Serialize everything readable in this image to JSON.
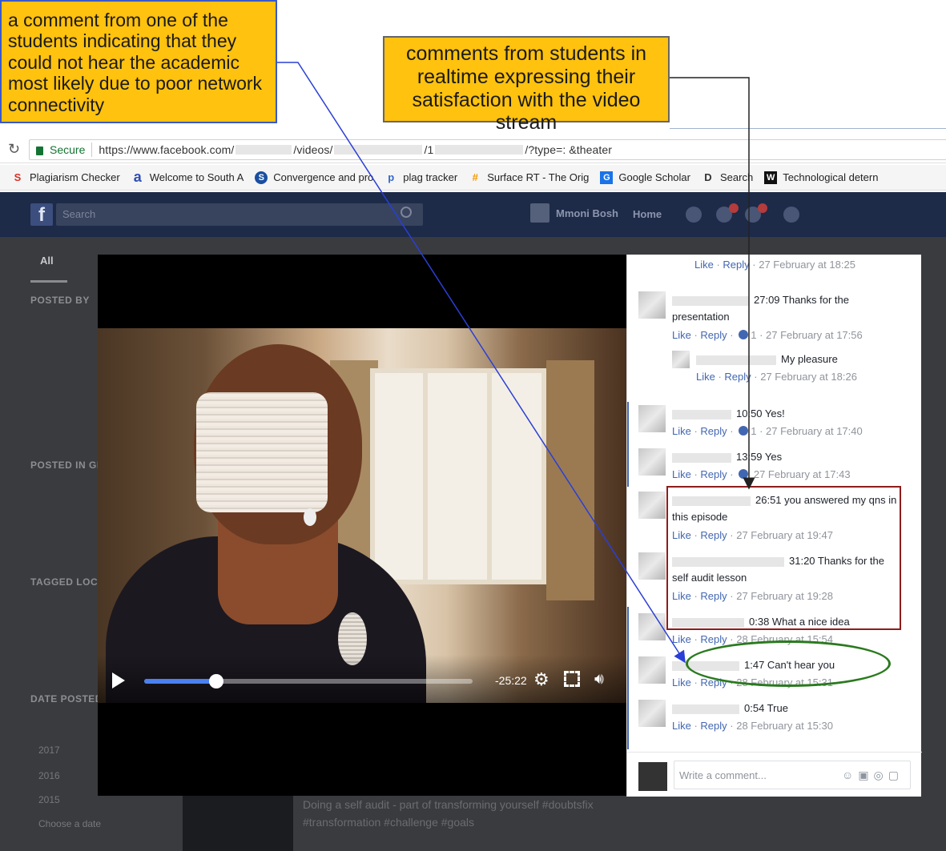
{
  "annotations": {
    "left_note": "a comment from one of the students indicating that they could not hear the academic most likely due to poor network connectivity",
    "right_note": "comments from students in realtime expressing their satisfaction with the video stream"
  },
  "browser": {
    "secure_label": "Secure",
    "url_prefix": "https://www.facebook.com/",
    "url_part_videos": "/videos/",
    "url_part_1": "/1",
    "url_suffix": "/?type=: &theater",
    "bookmarks": [
      {
        "icon": "S",
        "color": "#d93025",
        "label": "Plagiarism Checker"
      },
      {
        "icon": "a",
        "color": "#2f4db8",
        "label": "Welcome to South A"
      },
      {
        "icon": "S",
        "color": "#1a4fa0",
        "label": "Convergence and pro"
      },
      {
        "icon": "p",
        "color": "#3366cc",
        "label": "plag tracker"
      },
      {
        "icon": "#",
        "color": "#f29900",
        "label": "Surface RT - The Orig"
      },
      {
        "icon": "G",
        "color": "#1a73e8",
        "label": "Google Scholar"
      },
      {
        "icon": "D",
        "color": "#333333",
        "label": "Search"
      },
      {
        "icon": "W",
        "color": "#111111",
        "label": "Technological detern"
      }
    ]
  },
  "facebook": {
    "search_placeholder": "Search",
    "user_name": "Mmoni Bosh",
    "home_label": "Home",
    "tab_all": "All",
    "filters": {
      "posted_by": "POSTED BY",
      "posted_in": "POSTED IN GR",
      "tagged": "TAGGED LOC",
      "date_posted": "DATE POSTED",
      "years": [
        "2017",
        "2016",
        "2015"
      ],
      "choose_date": "Choose a date"
    },
    "below_video_text": "Doing a self audit - part of transforming yourself #doubtsfix #transformation #challenge #goals"
  },
  "video": {
    "time_remaining": "-25:22",
    "progress_fraction": 0.22
  },
  "comments": {
    "top_meta": {
      "like": "Like",
      "reply": "Reply",
      "time": "27 February at 18:25"
    },
    "c1": {
      "text": "27:09 Thanks for the presentation",
      "like": "Like",
      "reply": "Reply",
      "count": "1",
      "time": "27 February at 17:56"
    },
    "c1_reply": {
      "text": "My pleasure",
      "like": "Like",
      "reply": "Reply",
      "time": "27 February at 18:26"
    },
    "c2": {
      "text": "10:50 Yes!",
      "like": "Like",
      "reply": "Reply",
      "count": "1",
      "time": "27 February at 17:40"
    },
    "c3": {
      "text": "13:59 Yes",
      "like": "Like",
      "reply": "Reply",
      "time": "27 February at 17:43"
    },
    "c4": {
      "text": "26:51 you answered my qns in this episode",
      "like": "Like",
      "reply": "Reply",
      "time": "27 February at 19:47"
    },
    "c5": {
      "text": "31:20 Thanks for the self audit lesson",
      "like": "Like",
      "reply": "Reply",
      "time": "27 February at 19:28"
    },
    "c6": {
      "text": "0:38 What a nice idea",
      "like": "Like",
      "reply": "Reply",
      "time": "28 February at 15:54"
    },
    "c7": {
      "text": "1:47 Can't hear you",
      "like": "Like",
      "reply": "Reply",
      "time": "28 February at 15:31"
    },
    "c8": {
      "text": "0:54 True",
      "like": "Like",
      "reply": "Reply",
      "time": "28 February at 15:30"
    },
    "write_placeholder": "Write a comment..."
  },
  "colors": {
    "note_fill": "#ffc20e",
    "fb_blue": "#4267b2",
    "red_highlight": "#8e1c1c",
    "green_highlight": "#2a7a1e"
  }
}
